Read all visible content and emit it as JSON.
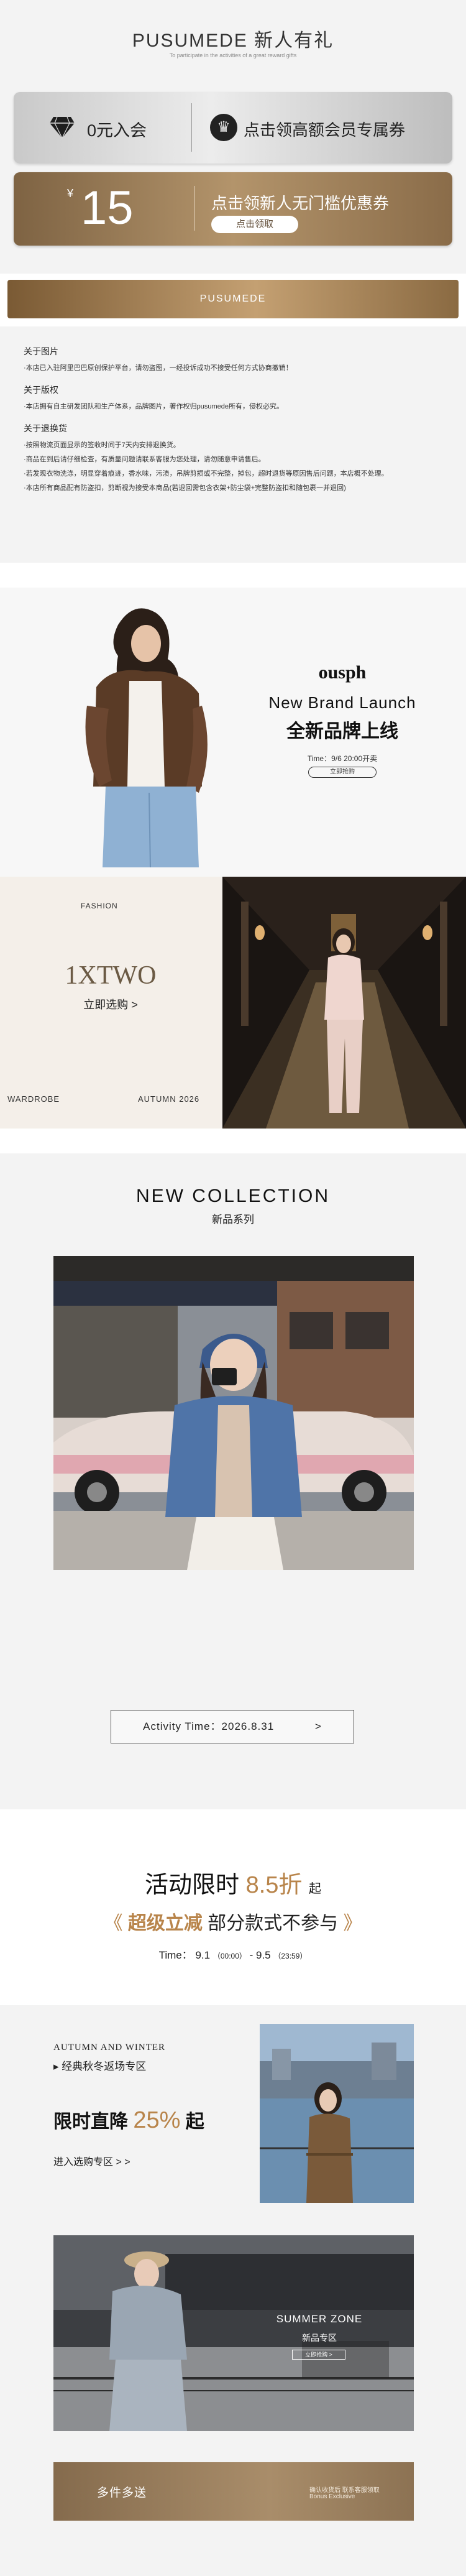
{
  "header": {
    "title": "PUSUMEDE 新人有礼",
    "subtitle": "To participate in the activities of a great reward gifts"
  },
  "coupons": {
    "silver": {
      "left_label": "0元入会",
      "right_label": "点击领高额会员专属券",
      "left_icon": "diamond-icon",
      "right_icon": "crown-icon"
    },
    "gold": {
      "currency": "¥",
      "amount": "15",
      "title": "点击领新人无门槛优惠券",
      "button": "点击领取"
    }
  },
  "banner": {
    "label": "PUSUMEDE"
  },
  "rules": {
    "sections": [
      {
        "heading": "关于图片",
        "lines": [
          "·本店已入驻阿里巴巴原创保护平台，请勿盗图，一经投诉成功不接受任何方式协商撤销！"
        ]
      },
      {
        "heading": "关于版权",
        "lines": [
          "·本店拥有自主研发团队和生产体系，品牌图片，著作权归pusumede所有，侵权必究。"
        ]
      },
      {
        "heading": "关于退换货",
        "lines": [
          "·按照物流页面显示的签收时间于7天内安排退换货。",
          "·商品在到后请仔细检查，有质量问题请联系客服为您处理，请勿随意申请售后。",
          "·若发现衣物洗涤，明显穿着痕迹，香水味，污渍，吊牌剪损或不完整，掉包，超时退货等原因售后问题，本店概不处理。",
          "·本店所有商品配有防盗扣，剪断视为接受本商品(若退回需包含衣架+防尘袋+完整防盗扣和随包裹一并退回)"
        ]
      }
    ]
  },
  "launch": {
    "brand": "ousph",
    "title_en": "New Brand Launch",
    "title_cn": "全新品牌上线",
    "time": "Time：9/6 20:00开卖",
    "button": "立即抢购"
  },
  "xtwo": {
    "tag": "FASHION",
    "title": "1XTWO",
    "cta": "立即选购 >",
    "left_caption": "WARDROBE",
    "right_caption": "AUTUMN 2026"
  },
  "collection": {
    "title_en": "NEW COLLECTION",
    "title_cn": "新品系列",
    "button": "Activity Time：2026.8.31",
    "button_arrow": ">"
  },
  "sale": {
    "title_prefix": "活动限时",
    "title_highlight": "8.5折",
    "title_suffix": "起",
    "line2_open": "《",
    "line2_highlight": "超级立减",
    "line2_rest": "部分款式不参与",
    "line2_close": "》",
    "time_label": "Time：",
    "time_start": "9.1",
    "time_start_small": "（00:00）",
    "time_sep": " - ",
    "time_end": "9.5",
    "time_end_small": "（23:59）"
  },
  "autumn_winter": {
    "title_en": "AUTUMN AND WINTER",
    "title_cn": "▸ 经典秋冬返场专区",
    "price_prefix": "限时直降",
    "price_highlight": "25%",
    "price_suffix": "起",
    "link": "进入选购专区 > >"
  },
  "summer_zone": {
    "title_en": "SUMMER ZONE",
    "title_cn": "新品专区",
    "button": "立即抢购 >",
    "bar_label": "多件多送",
    "bar_note_1": "确认收货后 联系客服领取",
    "bar_note_2": "Bonus Exclusive"
  },
  "colors": {
    "gold_accent": "#b8844a",
    "coupon_gold": "#a98763",
    "coupon_silver": "#dcdcdc",
    "brand_text": "#6b5a44"
  }
}
